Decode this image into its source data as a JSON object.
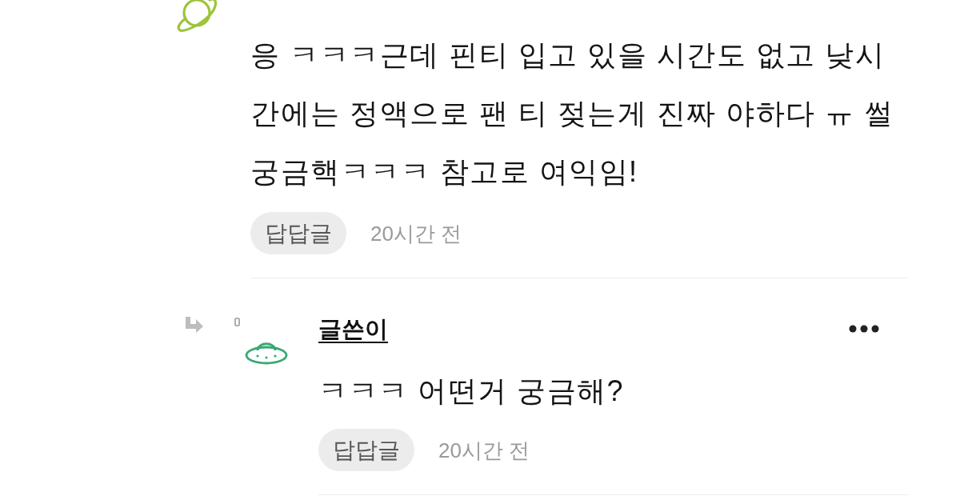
{
  "comment": {
    "text": "응 ㅋㅋㅋ근데 핀티 입고 있을 시간도 없고 낮시간에는 정액으로 팬 티 젖는게 진짜 야하다 ㅠ 썰 궁금핵ㅋㅋㅋ 참고로 여익임!",
    "reply_button": "답답글",
    "time": "20시간 전",
    "replies": [
      {
        "author": "글쓴이",
        "text": "ㅋㅋㅋ 어떤거 궁금해?",
        "reply_button": "답답글",
        "time": "20시간 전"
      }
    ]
  }
}
